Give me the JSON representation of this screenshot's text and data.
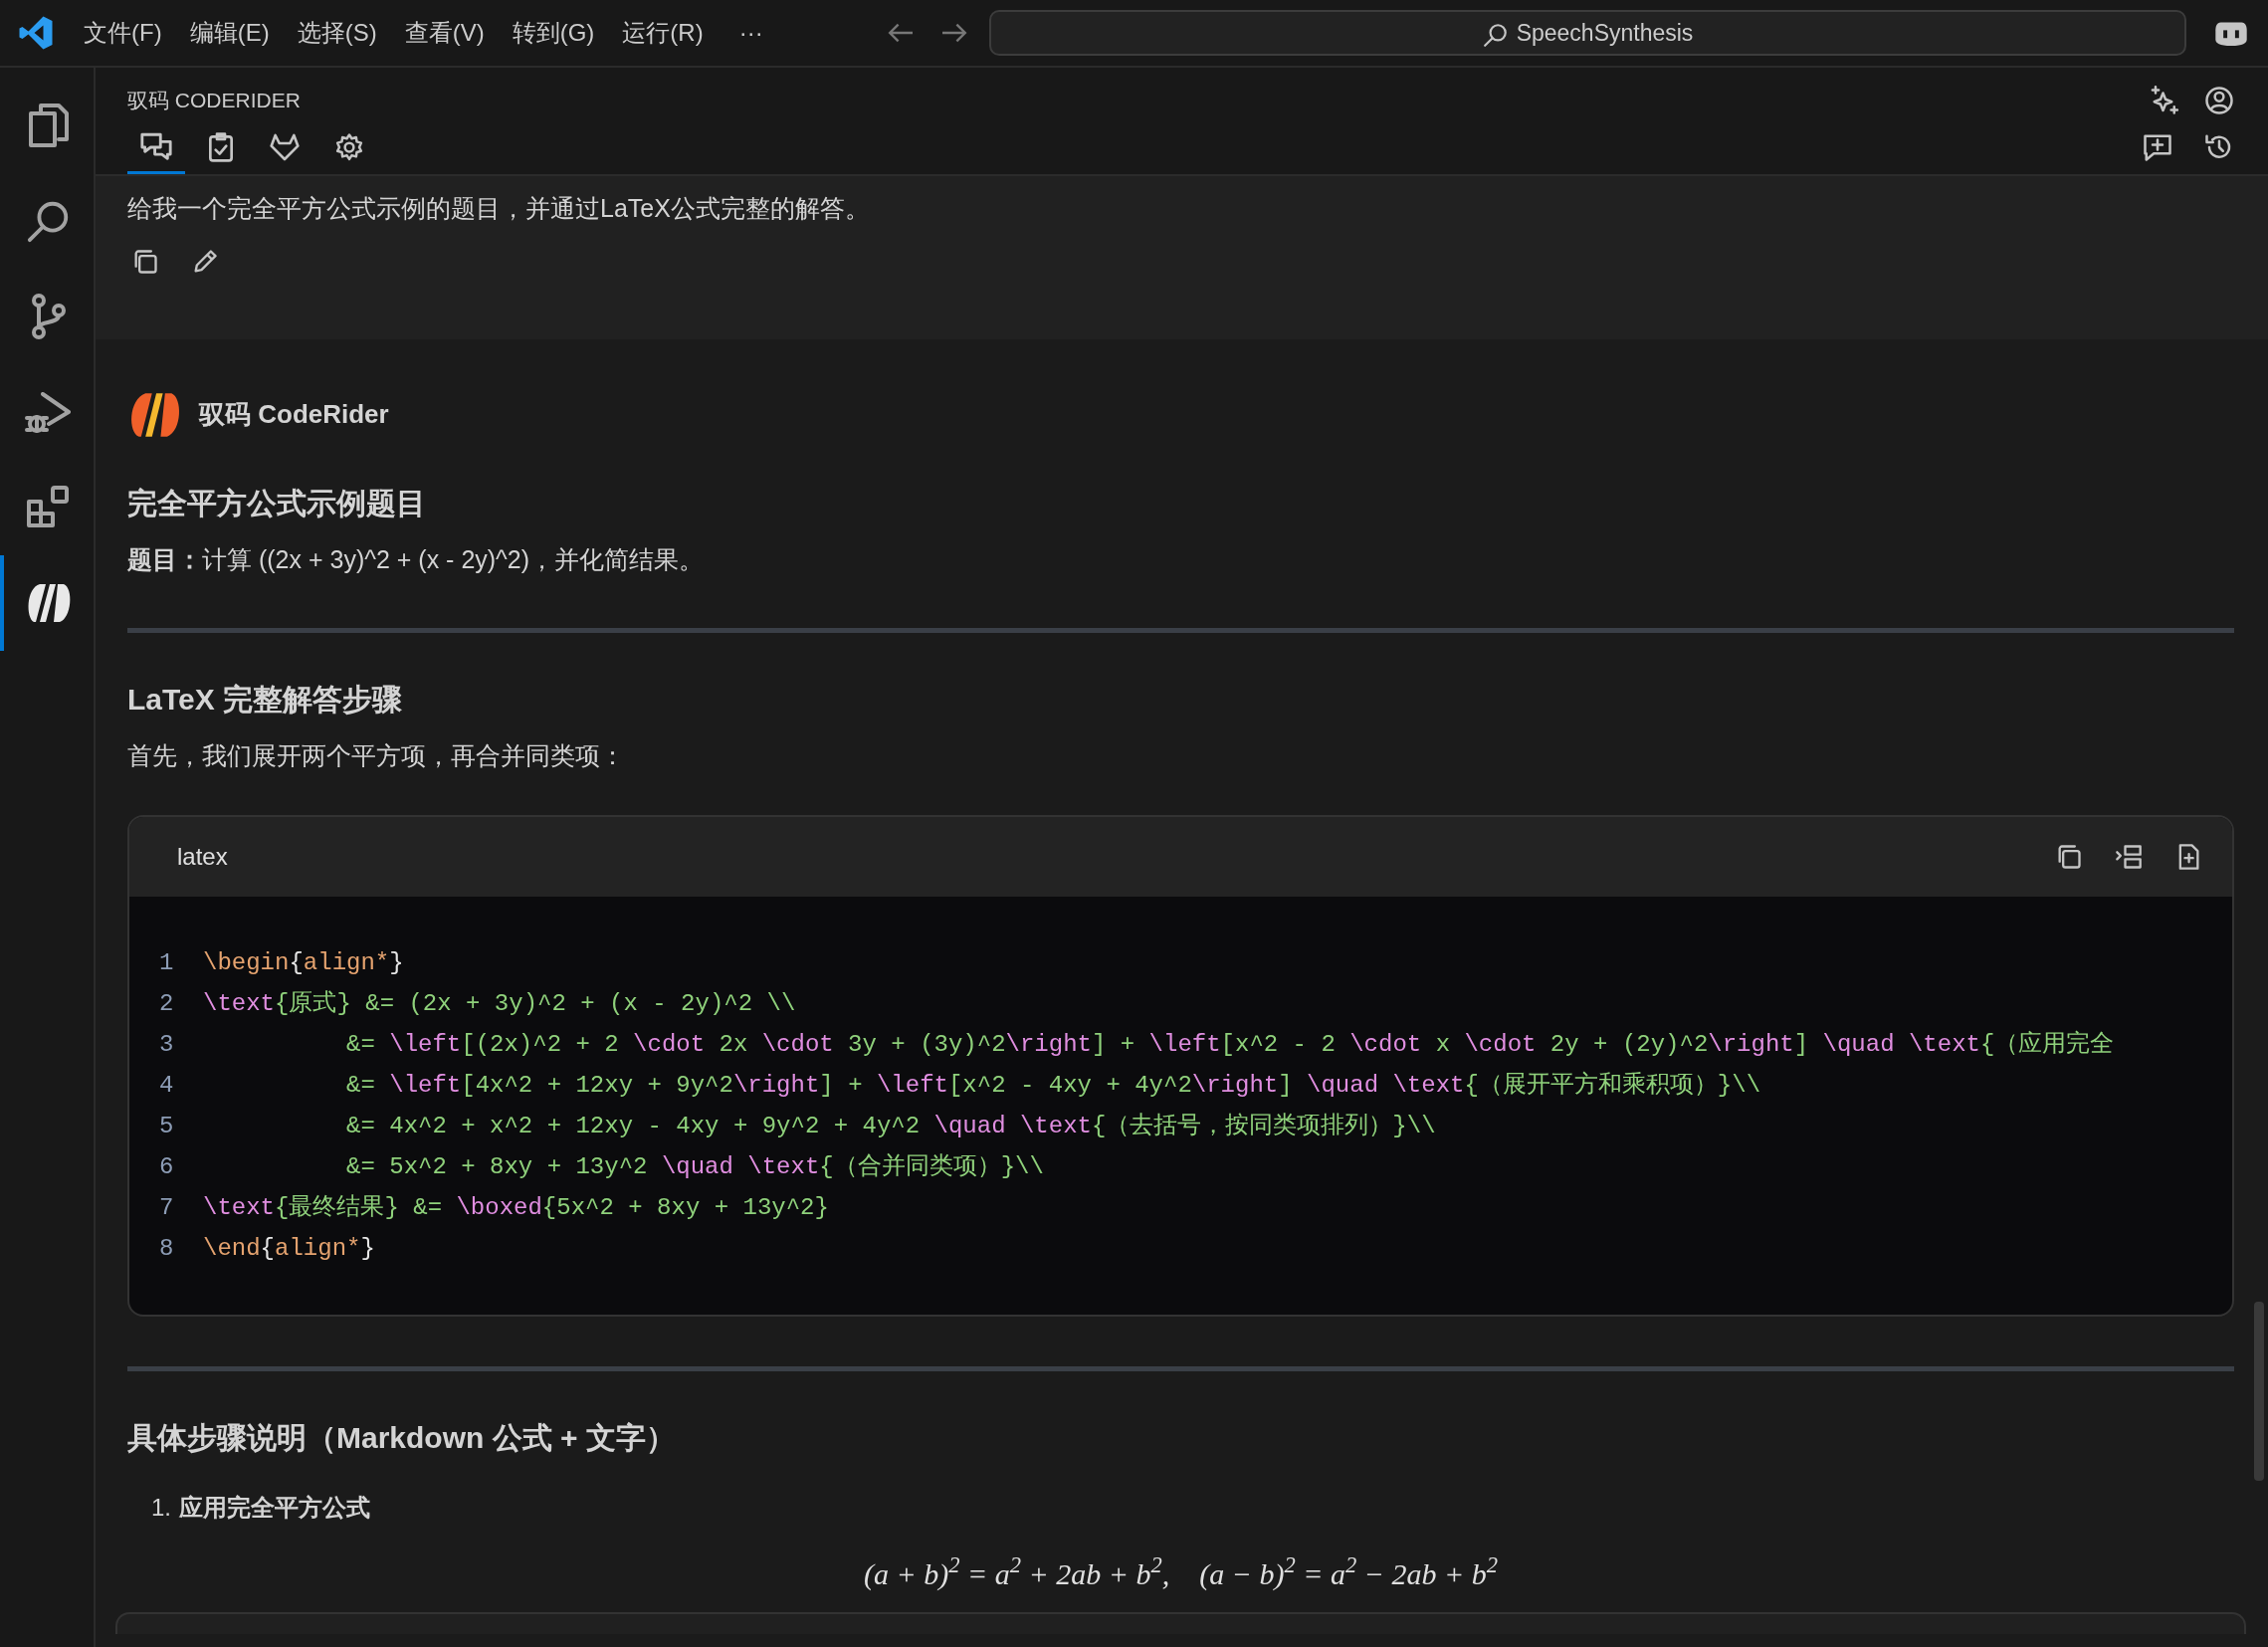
{
  "title_bar": {
    "menus": [
      "文件(F)",
      "编辑(E)",
      "选择(S)",
      "查看(V)",
      "转到(G)",
      "运行(R)"
    ],
    "more": "···",
    "search": {
      "value": "SpeechSynthesis"
    }
  },
  "activity_bar": [
    {
      "kind": "files",
      "selected": false
    },
    {
      "kind": "search",
      "selected": false
    },
    {
      "kind": "source_control",
      "selected": false
    },
    {
      "kind": "run_debug",
      "selected": false
    },
    {
      "kind": "extensions",
      "selected": false
    },
    {
      "kind": "coderider",
      "selected": true
    }
  ],
  "panel": {
    "title": "驭码 CODERIDER",
    "tabs": [
      {
        "kind": "chat",
        "selected": true
      },
      {
        "kind": "tasks",
        "selected": false
      },
      {
        "kind": "fox",
        "selected": false
      },
      {
        "kind": "settings",
        "selected": false
      }
    ]
  },
  "user_message": {
    "text": "给我一个完全平方公式示例的题目，并通过LaTeX公式完整的解答。"
  },
  "response": {
    "author": "驭码 CodeRider",
    "blocks": [
      {
        "kind": "heading",
        "text": "完全平方公式示例题目"
      },
      {
        "kind": "paragraph",
        "text": "**题目：**计算 ((2x + 3y)^2 + (x - 2y)^2)，并化简结果。"
      },
      {
        "kind": "rule"
      },
      {
        "kind": "heading",
        "text": "LaTeX 完整解答步骤"
      },
      {
        "kind": "paragraph",
        "text": "首先，我们展开两个平方项，再合并同类项："
      },
      {
        "kind": "code",
        "language": "latex",
        "lines": [
          {
            "number": "1",
            "tokens": [
              {
                "t": "\\begin",
                "kind": "keyword"
              },
              {
                "t": "{",
                "kind": "punct"
              },
              {
                "t": "align*",
                "kind": "keyword"
              },
              {
                "t": "}",
                "kind": "punct"
              }
            ]
          },
          {
            "number": "2",
            "tokens": [
              {
                "t": "\\text",
                "kind": "command"
              },
              {
                "t": "{原式} &= (2x + 3y)^2 + (x - 2y)^2 \\\\",
                "kind": "plain"
              }
            ]
          },
          {
            "number": "3",
            "tokens": [
              {
                "t": "          &= ",
                "kind": "plain"
              },
              {
                "t": "\\left",
                "kind": "command"
              },
              {
                "t": "[(2x)^2 + 2 ",
                "kind": "plain"
              },
              {
                "t": "\\cdot",
                "kind": "command"
              },
              {
                "t": " 2x ",
                "kind": "plain"
              },
              {
                "t": "\\cdot",
                "kind": "command"
              },
              {
                "t": " 3y + (3y)^2",
                "kind": "plain"
              },
              {
                "t": "\\right",
                "kind": "command"
              },
              {
                "t": "] + ",
                "kind": "plain"
              },
              {
                "t": "\\left",
                "kind": "command"
              },
              {
                "t": "[x^2 - 2 ",
                "kind": "plain"
              },
              {
                "t": "\\cdot",
                "kind": "command"
              },
              {
                "t": " x ",
                "kind": "plain"
              },
              {
                "t": "\\cdot",
                "kind": "command"
              },
              {
                "t": " 2y + (2y)^2",
                "kind": "plain"
              },
              {
                "t": "\\right",
                "kind": "command"
              },
              {
                "t": "] ",
                "kind": "plain"
              },
              {
                "t": "\\quad \\text",
                "kind": "command"
              },
              {
                "t": "{（应用完全",
                "kind": "plain"
              }
            ]
          },
          {
            "number": "4",
            "tokens": [
              {
                "t": "          &= ",
                "kind": "plain"
              },
              {
                "t": "\\left",
                "kind": "command"
              },
              {
                "t": "[4x^2 + 12xy + 9y^2",
                "kind": "plain"
              },
              {
                "t": "\\right",
                "kind": "command"
              },
              {
                "t": "] + ",
                "kind": "plain"
              },
              {
                "t": "\\left",
                "kind": "command"
              },
              {
                "t": "[x^2 - 4xy + 4y^2",
                "kind": "plain"
              },
              {
                "t": "\\right",
                "kind": "command"
              },
              {
                "t": "] ",
                "kind": "plain"
              },
              {
                "t": "\\quad \\text",
                "kind": "command"
              },
              {
                "t": "{（展开平方和乘积项）}\\\\",
                "kind": "plain"
              }
            ]
          },
          {
            "number": "5",
            "tokens": [
              {
                "t": "          &= 4x^2 + x^2 + 12xy - 4xy + 9y^2 + 4y^2 ",
                "kind": "plain"
              },
              {
                "t": "\\quad \\text",
                "kind": "command"
              },
              {
                "t": "{（去括号，按同类项排列）}\\\\",
                "kind": "plain"
              }
            ]
          },
          {
            "number": "6",
            "tokens": [
              {
                "t": "          &= 5x^2 + 8xy + 13y^2 ",
                "kind": "plain"
              },
              {
                "t": "\\quad \\text",
                "kind": "command"
              },
              {
                "t": "{（合并同类项）}\\\\",
                "kind": "plain"
              }
            ]
          },
          {
            "number": "7",
            "tokens": [
              {
                "t": "\\text",
                "kind": "command"
              },
              {
                "t": "{最终结果} &= ",
                "kind": "plain"
              },
              {
                "t": "\\boxed",
                "kind": "command"
              },
              {
                "t": "{5x^2 + 8xy + 13y^2}",
                "kind": "plain"
              }
            ]
          },
          {
            "number": "8",
            "tokens": [
              {
                "t": "\\end",
                "kind": "keyword"
              },
              {
                "t": "{",
                "kind": "punct"
              },
              {
                "t": "align*",
                "kind": "keyword"
              },
              {
                "t": "}",
                "kind": "punct"
              }
            ]
          }
        ]
      },
      {
        "kind": "rule"
      },
      {
        "kind": "heading",
        "text": "具体步骤说明（Markdown 公式 + 文字）"
      },
      {
        "kind": "list_item",
        "number": "1.",
        "text": "应用完全平方公式"
      },
      {
        "kind": "formula",
        "text": "(a + b)$^{2}$ = a$^{2}$ + 2ab + b$^{2}$,    (a − b)$^{2}$ = a$^{2}$ − 2ab + b$^{2}$"
      },
      {
        "kind": "code_cut"
      }
    ]
  }
}
